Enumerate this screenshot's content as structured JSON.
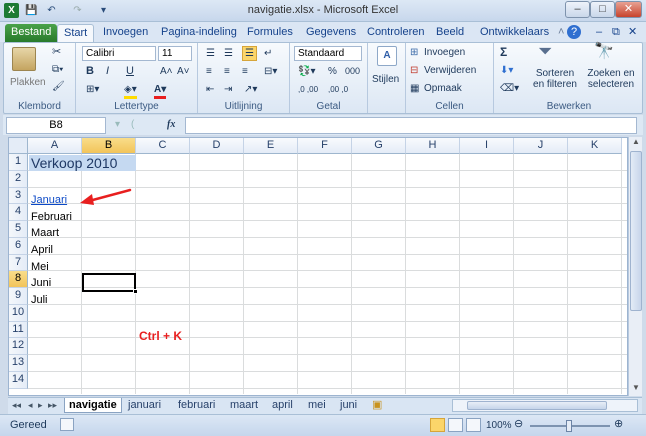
{
  "window": {
    "title": "navigatie.xlsx - Microsoft Excel",
    "minimize": "–",
    "maximize": "□",
    "close": "✕",
    "app_icon": "X"
  },
  "quick_access": {
    "save": "💾",
    "undo": "↶",
    "redo": "↷",
    "customize": "▾"
  },
  "ribbon_tabs": [
    {
      "label": "Bestand"
    },
    {
      "label": "Start"
    },
    {
      "label": "Invoegen"
    },
    {
      "label": "Pagina-indeling"
    },
    {
      "label": "Formules"
    },
    {
      "label": "Gegevens"
    },
    {
      "label": "Controleren"
    },
    {
      "label": "Beeld"
    },
    {
      "label": "Ontwikkelaars"
    }
  ],
  "ribbon": {
    "clipboard": {
      "paste": "Plakken",
      "label": "Klembord"
    },
    "font": {
      "name": "Calibri",
      "size": "11",
      "bold": "B",
      "italic": "I",
      "underline": "U",
      "grow": "A˄",
      "shrink": "A˅",
      "label": "Lettertype"
    },
    "alignment": {
      "label": "Uitlijning"
    },
    "number": {
      "format": "Standaard",
      "percent": "%",
      "thousands": "000",
      "dec_inc": ",0 ,00",
      "dec_dec": ",00 ,0",
      "label": "Getal"
    },
    "styles": {
      "label": "Stijlen"
    },
    "cells": {
      "insert": "Invoegen",
      "delete": "Verwijderen",
      "format": "Opmaak",
      "label": "Cellen"
    },
    "editing": {
      "sigma": "Σ",
      "sort": "Sorteren en filteren",
      "find": "Zoeken en selecteren",
      "label": "Bewerken"
    }
  },
  "formula_bar": {
    "name_box": "B8",
    "fx": "fx",
    "value": ""
  },
  "columns": [
    "A",
    "B",
    "C",
    "D",
    "E",
    "F",
    "G",
    "H",
    "I",
    "J",
    "K"
  ],
  "rows": [
    "1",
    "2",
    "3",
    "4",
    "5",
    "6",
    "7",
    "8",
    "9",
    "10",
    "11",
    "12",
    "13",
    "14"
  ],
  "cells": {
    "a1": "Verkoop 2010",
    "a3": "Januari",
    "a4": "Februari",
    "a5": "Maart",
    "a6": "April",
    "a7": "Mei",
    "a8": "Juni",
    "a9": "Juli",
    "c11": "Ctrl + K"
  },
  "selected_cell": "B8",
  "sheet_tabs": [
    "navigatie",
    "januari",
    "februari",
    "maart",
    "april",
    "mei",
    "juni"
  ],
  "status_bar": {
    "ready": "Gereed",
    "zoom": "100%"
  },
  "colors": {
    "accent_green": "#2e7d32",
    "hyperlink": "#0b49c7",
    "annotation_red": "#e81f1f",
    "title_fill": "#c5d9f1"
  }
}
